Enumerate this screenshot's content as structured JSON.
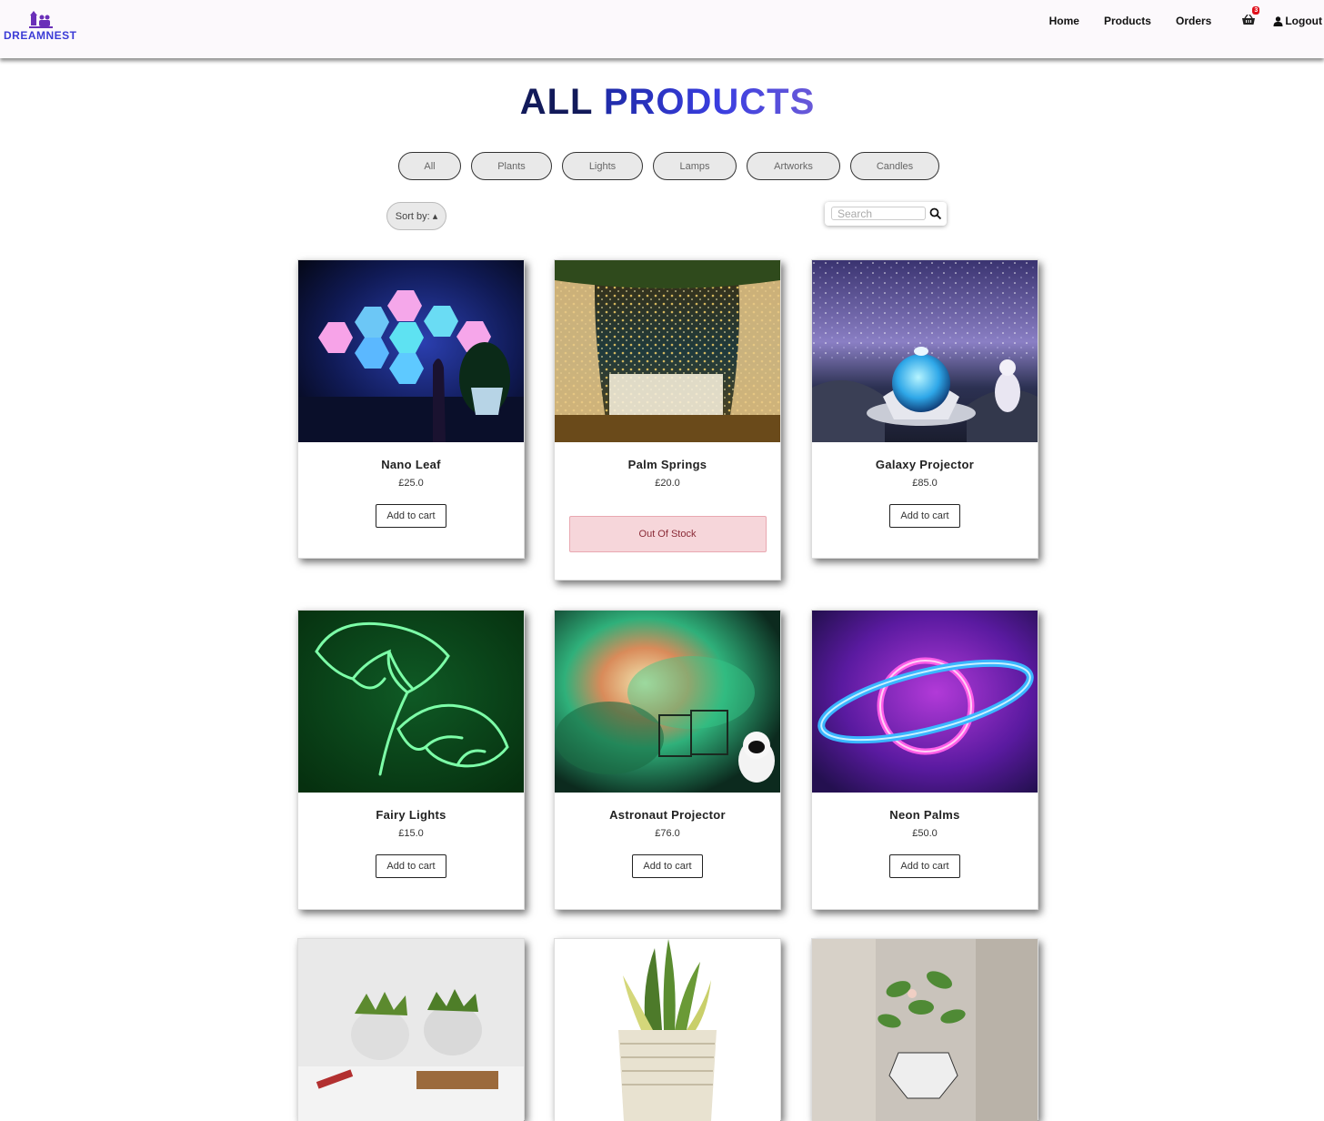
{
  "brand": {
    "name": "DREAMNEST"
  },
  "nav": {
    "links": [
      "Home",
      "Products",
      "Orders"
    ],
    "cart_count": "3",
    "logout_label": "Logout"
  },
  "page": {
    "title_a": "ALL",
    "title_b": "PRODUCTS"
  },
  "filters": [
    "All",
    "Plants",
    "Lights",
    "Lamps",
    "Artworks",
    "Candles"
  ],
  "sort": {
    "label": "Sort by: ▴"
  },
  "search": {
    "placeholder": "Search"
  },
  "products": [
    {
      "name": "Nano Leaf",
      "price": "£25.0",
      "action": "Add to cart"
    },
    {
      "name": "Palm Springs",
      "price": "£20.0",
      "status": "Out Of Stock"
    },
    {
      "name": "Galaxy Projector",
      "price": "£85.0",
      "action": "Add to cart"
    },
    {
      "name": "Fairy Lights",
      "price": "£15.0",
      "action": "Add to cart"
    },
    {
      "name": "Astronaut Projector",
      "price": "£76.0",
      "action": "Add to cart"
    },
    {
      "name": "Neon Palms",
      "price": "£50.0",
      "action": "Add to cart"
    }
  ],
  "colors": {
    "accent": "#3a3ee0",
    "title_dark": "#121a5a",
    "badge": "#e0101b",
    "oos_bg": "#f6d6da"
  }
}
